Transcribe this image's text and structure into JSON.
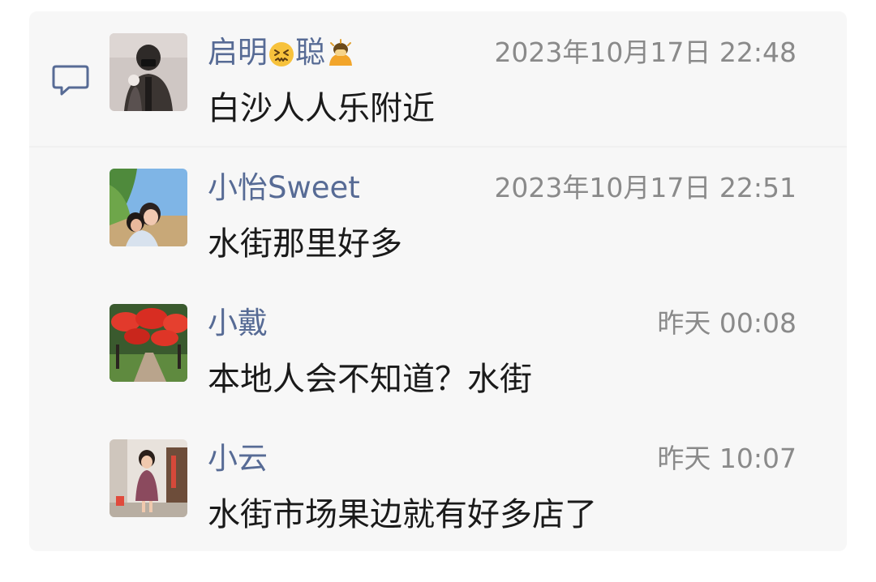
{
  "icons": {
    "comment": "comment-bubble-icon",
    "name_emoji_1": "confounded-face-emoji",
    "name_emoji_2": "person-bowing-emoji"
  },
  "colors": {
    "name": "#576b95",
    "time": "#8a8a8a",
    "text": "#1a1a1a",
    "panel_bg": "#f7f7f7"
  },
  "comments": [
    {
      "name_part1": "启明",
      "name_part2": "聪",
      "time": "2023年10月17日 22:48",
      "content": "白沙人人乐附近"
    },
    {
      "name": "小怡Sweet",
      "time": "2023年10月17日 22:51",
      "content": "水街那里好多"
    },
    {
      "name": "小戴",
      "time": "昨天 00:08",
      "content": "本地人会不知道？水街"
    },
    {
      "name": "小云",
      "time": "昨天 10:07",
      "content": "水街市场果边就有好多店了"
    }
  ]
}
